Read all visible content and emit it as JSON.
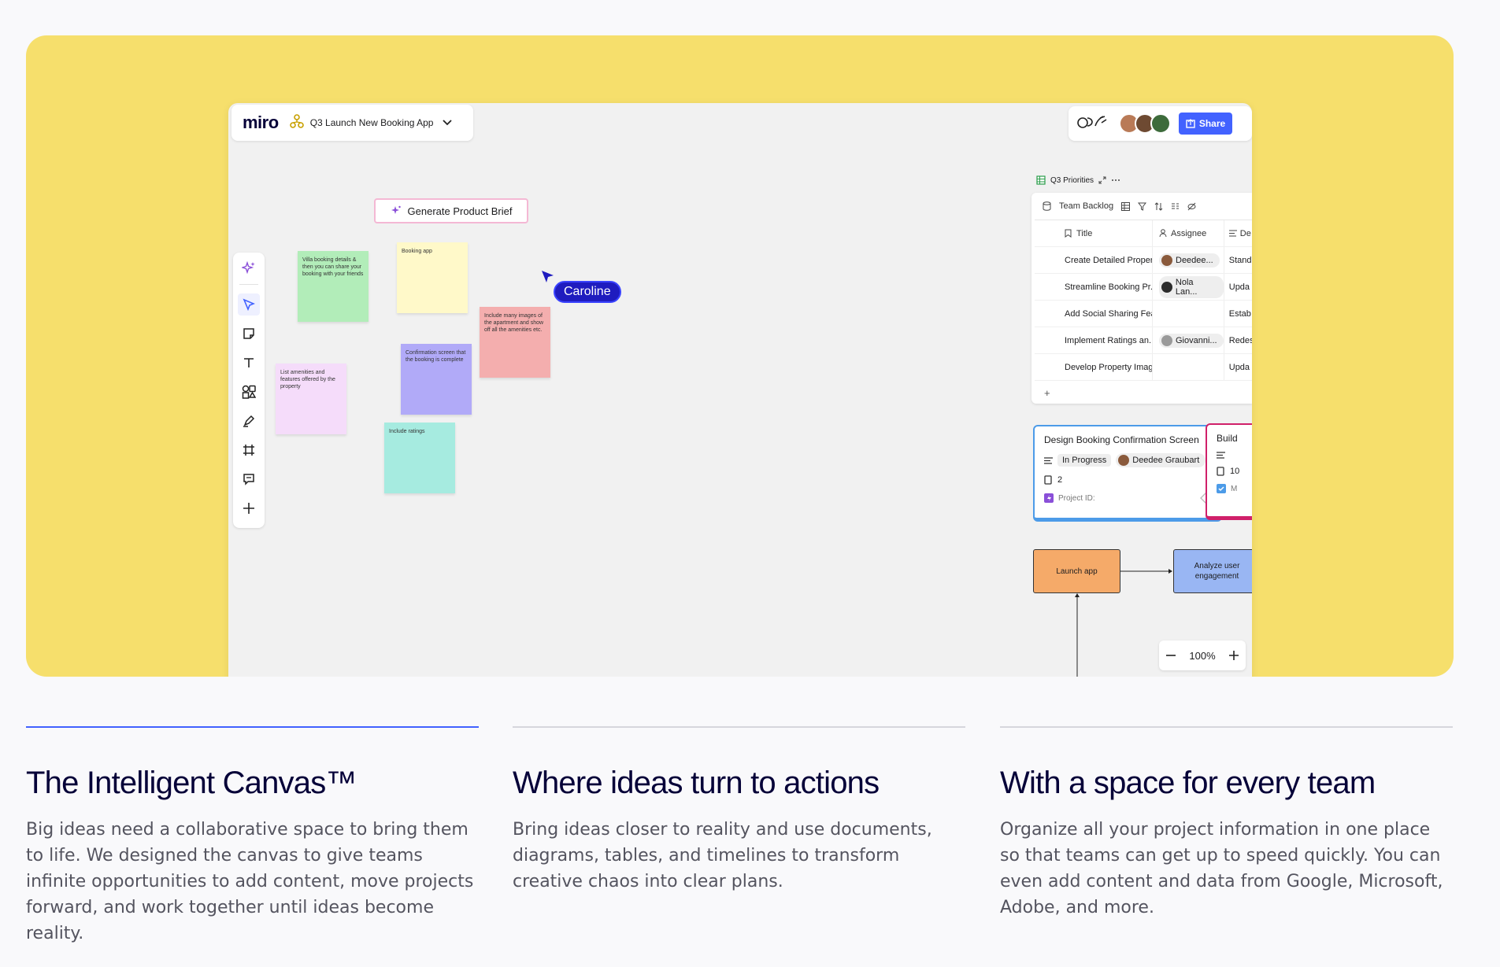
{
  "board": {
    "logo": "miro",
    "board_name": "Q3 Launch New Booking App",
    "share_label": "Share",
    "generate_button": "Generate Product Brief",
    "zoom": "100%"
  },
  "stickies": [
    {
      "text": "Villa booking details & then you can share your booking with your friends",
      "color": "#b2edb9"
    },
    {
      "text": "Booking app",
      "color": "#fff9c9"
    },
    {
      "text": "Include many images of the apartment and show off all the amenities etc.",
      "color": "#f4aeae"
    },
    {
      "text": "Confirmation screen that the booking is complete",
      "color": "#b1aaf8"
    },
    {
      "text": "List amenities and features offered by the property",
      "color": "#f5dcfa"
    },
    {
      "text": "Include ratings",
      "color": "#a6ebe0"
    }
  ],
  "cursor": {
    "name": "Caroline"
  },
  "table": {
    "widget_title": "Q3 Priorities",
    "view_name": "Team Backlog",
    "columns": [
      "Title",
      "Assignee",
      "De"
    ],
    "rows": [
      {
        "title": "Create Detailed Proper...",
        "assignee": "Deedee...",
        "desc": "Stand"
      },
      {
        "title": "Streamline Booking Pr...",
        "assignee": "Nola Lan...",
        "desc": "Upda"
      },
      {
        "title": "Add Social Sharing Fea...",
        "assignee": "",
        "desc": "Estab"
      },
      {
        "title": "Implement Ratings an...",
        "assignee": "Giovanni...",
        "desc": "Redes"
      },
      {
        "title": "Develop Property Imag...",
        "assignee": "",
        "desc": "Upda"
      }
    ],
    "add_row": "+"
  },
  "cards": [
    {
      "title": "Design Booking Confirmation Screen",
      "status": "In Progress",
      "assignee": "Deedee Graubart",
      "count": "2",
      "project_label": "Project ID:"
    },
    {
      "title": "Build",
      "count": "10",
      "check_label": "M"
    }
  ],
  "flow": {
    "box1": "Launch app",
    "box2": "Analyze user engagement"
  },
  "features": [
    {
      "title": "The Intelligent Canvas™",
      "body": "Big ideas need a collaborative space to bring them to life. We designed the canvas to give teams infinite opportunities to add content, move projects forward, and work together until ideas become reality."
    },
    {
      "title": "Where ideas turn to actions",
      "body": "Bring ideas closer to reality and use documents, diagrams, tables, and timelines to transform creative chaos into clear plans."
    },
    {
      "title": "With a space for every team",
      "body": "Organize all your project information in one place so that teams can get up to speed quickly. You can even add content and data from Google, Microsoft, Adobe, and more."
    }
  ],
  "colors": {
    "hero_bg": "#f6df6c",
    "accent": "#4262ff",
    "cursor": "#1f1cbf"
  }
}
